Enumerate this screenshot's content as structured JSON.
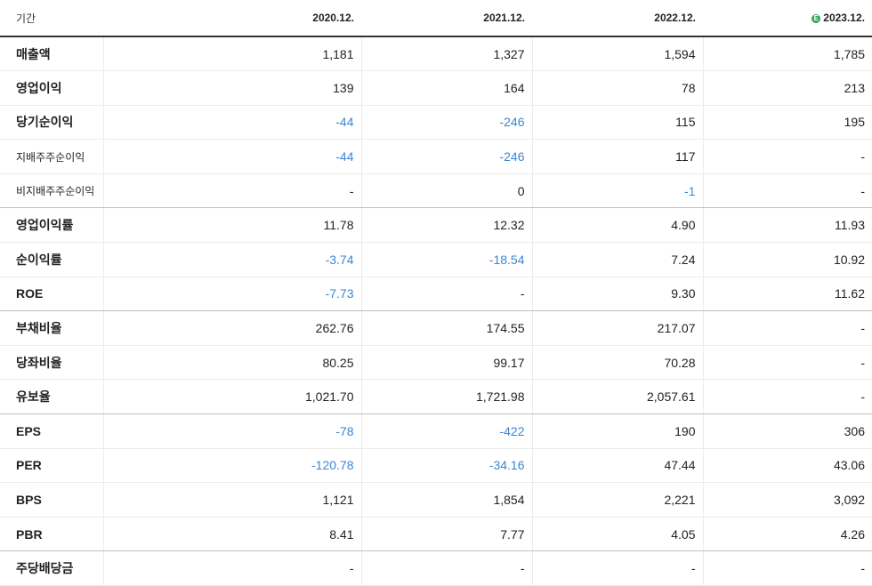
{
  "header": {
    "period_label": "기간",
    "columns": [
      "2020.12.",
      "2021.12.",
      "2022.12.",
      "2023.12."
    ],
    "estimate_badge": "E"
  },
  "rows": [
    {
      "label": "매출액",
      "values": [
        "1,181",
        "1,327",
        "1,594",
        "1,785"
      ]
    },
    {
      "label": "영업이익",
      "values": [
        "139",
        "164",
        "78",
        "213"
      ]
    },
    {
      "label": "당기순이익",
      "values": [
        "-44",
        "-246",
        "115",
        "195"
      ]
    },
    {
      "label": "지배주주순이익",
      "values": [
        "-44",
        "-246",
        "117",
        "-"
      ]
    },
    {
      "label": "비지배주주순이익",
      "values": [
        "-",
        "0",
        "-1",
        "-"
      ]
    },
    {
      "label": "영업이익률",
      "values": [
        "11.78",
        "12.32",
        "4.90",
        "11.93"
      ]
    },
    {
      "label": "순이익률",
      "values": [
        "-3.74",
        "-18.54",
        "7.24",
        "10.92"
      ]
    },
    {
      "label": "ROE",
      "values": [
        "-7.73",
        "-",
        "9.30",
        "11.62"
      ]
    },
    {
      "label": "부채비율",
      "values": [
        "262.76",
        "174.55",
        "217.07",
        "-"
      ]
    },
    {
      "label": "당좌비율",
      "values": [
        "80.25",
        "99.17",
        "70.28",
        "-"
      ]
    },
    {
      "label": "유보율",
      "values": [
        "1,021.70",
        "1,721.98",
        "2,057.61",
        "-"
      ]
    },
    {
      "label": "EPS",
      "values": [
        "-78",
        "-422",
        "190",
        "306"
      ]
    },
    {
      "label": "PER",
      "values": [
        "-120.78",
        "-34.16",
        "47.44",
        "43.06"
      ]
    },
    {
      "label": "BPS",
      "values": [
        "1,121",
        "1,854",
        "2,221",
        "3,092"
      ]
    },
    {
      "label": "PBR",
      "values": [
        "8.41",
        "7.77",
        "4.05",
        "4.26"
      ]
    },
    {
      "label": "주당배당금",
      "values": [
        "-",
        "-",
        "-",
        "-"
      ]
    }
  ],
  "colors": {
    "negative": "#3a87d3",
    "estimate_badge": "#35a55a"
  }
}
